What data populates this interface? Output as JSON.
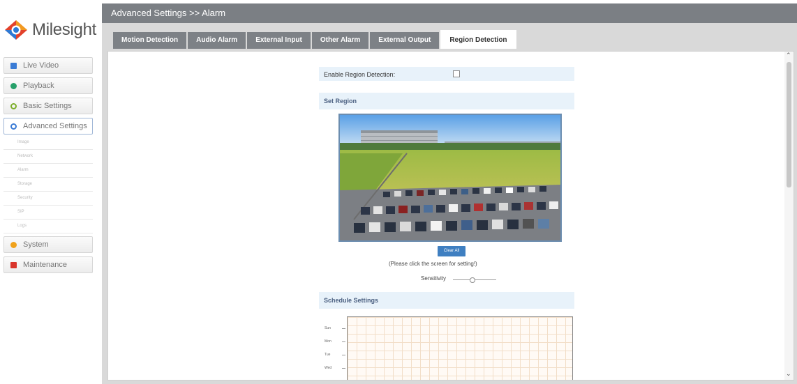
{
  "app": {
    "logo_text": "Milesight"
  },
  "header": {
    "title": "Advanced Settings >> Alarm"
  },
  "nav": {
    "items": [
      {
        "label": "Live Video",
        "icon": "video-icon",
        "color": "#3a7bd5"
      },
      {
        "label": "Playback",
        "icon": "playback-icon",
        "color": "#27a06a"
      },
      {
        "label": "Basic Settings",
        "icon": "gear-icon",
        "color": "#7cae2a"
      },
      {
        "label": "Advanced Settings",
        "icon": "advanced-gear-icon",
        "color": "#3a7bd5"
      },
      {
        "label": "System",
        "icon": "system-icon",
        "color": "#f0a21b"
      },
      {
        "label": "Maintenance",
        "icon": "maintenance-icon",
        "color": "#d9352b"
      }
    ],
    "sub_items": [
      "Image",
      "Network",
      "Alarm",
      "Storage",
      "Security",
      "SIP",
      "Logs"
    ]
  },
  "tabs": [
    "Motion Detection",
    "Audio Alarm",
    "External Input",
    "Other Alarm",
    "External Output",
    "Region Detection"
  ],
  "active_tab": "Region Detection",
  "region": {
    "enable_label": "Enable Region Detection:",
    "enabled": false,
    "set_region_title": "Set Region",
    "clear_button": "Clear All",
    "hint": "(Please click the screen for setting!)",
    "sensitivity_label": "Sensitivity",
    "sensitivity_value": 0.45,
    "schedule_title": "Schedule Settings",
    "schedule_days": [
      "Sun",
      "Mon",
      "Tue",
      "Wed"
    ]
  },
  "colors": {
    "accent": "#3f7fc1",
    "titlebar": "#7b7f84",
    "section_bg": "#e8f2fa"
  }
}
